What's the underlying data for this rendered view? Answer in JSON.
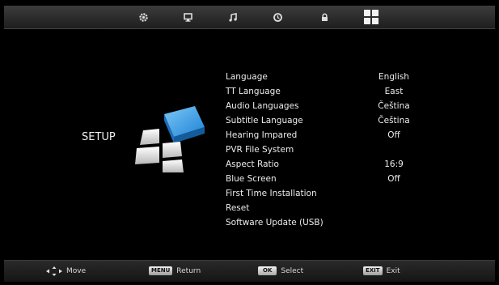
{
  "tabs": [
    {
      "name": "picture",
      "icon": "gear-icon"
    },
    {
      "name": "display",
      "icon": "monitor-icon"
    },
    {
      "name": "sound",
      "icon": "music-note-icon"
    },
    {
      "name": "time",
      "icon": "clock-icon"
    },
    {
      "name": "lock",
      "icon": "lock-icon"
    },
    {
      "name": "setup",
      "icon": "setup-grid-icon",
      "active": true
    }
  ],
  "side": {
    "title": "SETUP"
  },
  "menu": [
    {
      "label": "Language",
      "value": "English"
    },
    {
      "label": "TT Language",
      "value": "East"
    },
    {
      "label": "Audio Languages",
      "value": "Čeština"
    },
    {
      "label": "Subtitle Language",
      "value": "Čeština"
    },
    {
      "label": "Hearing Impared",
      "value": "Off"
    },
    {
      "label": "PVR File System",
      "value": ""
    },
    {
      "label": "Aspect Ratio",
      "value": "16:9"
    },
    {
      "label": "Blue Screen",
      "value": "Off"
    },
    {
      "label": "First Time Installation",
      "value": ""
    },
    {
      "label": "Reset",
      "value": ""
    },
    {
      "label": "Software Update (USB)",
      "value": ""
    }
  ],
  "footer": {
    "move_label": "Move",
    "menu_key": "MENU",
    "return_label": "Return",
    "ok_key": "OK",
    "select_label": "Select",
    "exit_key": "EXIT",
    "exit_label": "Exit"
  },
  "colors": {
    "accent_blue": "#3aa0e6",
    "bar": "#2f2f2f",
    "background": "#000000"
  }
}
